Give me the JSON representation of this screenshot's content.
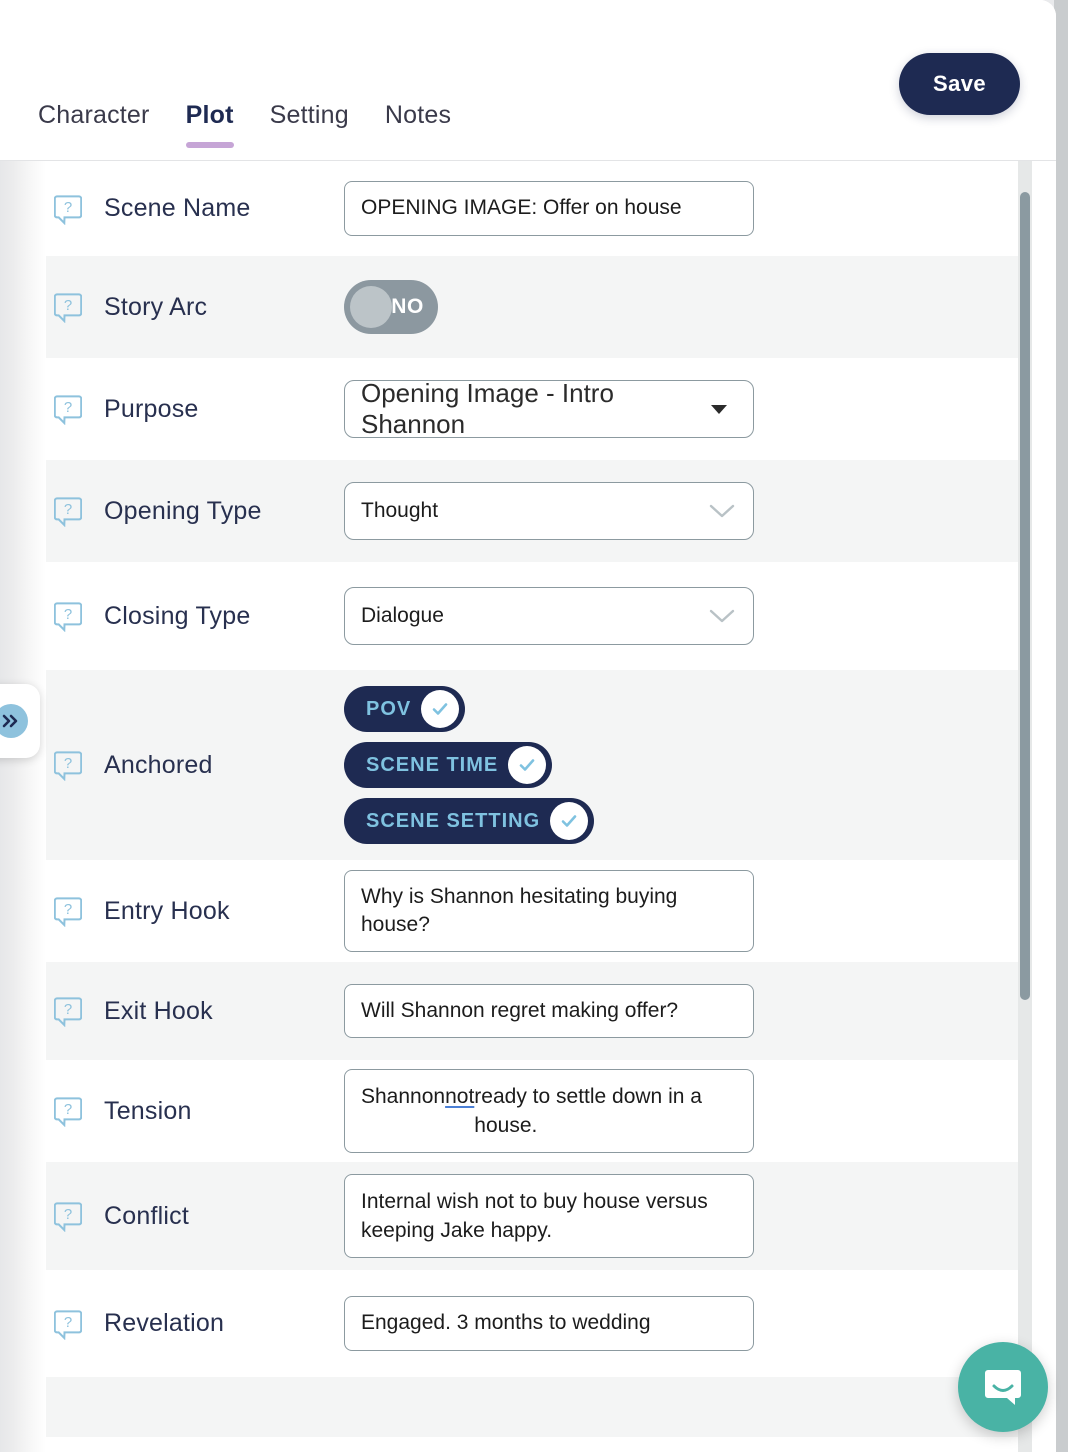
{
  "header": {
    "tabs": [
      {
        "label": "Character",
        "active": false
      },
      {
        "label": "Plot",
        "active": true
      },
      {
        "label": "Setting",
        "active": false
      },
      {
        "label": "Notes",
        "active": false
      }
    ],
    "save_label": "Save"
  },
  "colors": {
    "navy": "#1e2a52",
    "tab_underline": "#c6a5d6",
    "help_icon": "#8ec2dd",
    "pill_text": "#7fc2e0",
    "toggle_off": "#8c98a0",
    "chat_teal": "#49b3a5",
    "field_border": "#8c9aa0",
    "row_grey": "#f4f5f5"
  },
  "form": {
    "help_icon_name": "question-bubble-icon",
    "rows": [
      {
        "label": "Scene Name",
        "type": "text",
        "value": "OPENING IMAGE: Offer on house"
      },
      {
        "label": "Story Arc",
        "type": "toggle",
        "value": "NO",
        "on": false
      },
      {
        "label": "Purpose",
        "type": "select-solid",
        "value": "Opening Image - Intro Shannon"
      },
      {
        "label": "Opening Type",
        "type": "select-chevron",
        "value": "Thought"
      },
      {
        "label": "Closing Type",
        "type": "select-chevron",
        "value": "Dialogue"
      },
      {
        "label": "Anchored",
        "type": "pills",
        "pills": [
          {
            "label": "POV",
            "checked": true
          },
          {
            "label": "SCENE TIME",
            "checked": true
          },
          {
            "label": "SCENE SETTING",
            "checked": true
          }
        ]
      },
      {
        "label": "Entry Hook",
        "type": "text",
        "value": "Why is Shannon hesitating buying house?"
      },
      {
        "label": "Exit Hook",
        "type": "text",
        "value": "Will Shannon regret making offer?"
      },
      {
        "label": "Tension",
        "type": "text-rich",
        "value_pre": "Shannon ",
        "value_underline": "not",
        "value_post": " ready to settle down in a house."
      },
      {
        "label": "Conflict",
        "type": "text",
        "value": "Internal wish not to buy house versus keeping Jake happy."
      },
      {
        "label": "Revelation",
        "type": "text",
        "value": "Engaged. 3 months to wedding"
      }
    ]
  },
  "controls": {
    "collapse_handle_icon": "double-chevron-right-icon",
    "chat_launcher_icon": "chat-bubble-icon",
    "scrollbar_name": "vertical-scrollbar"
  }
}
